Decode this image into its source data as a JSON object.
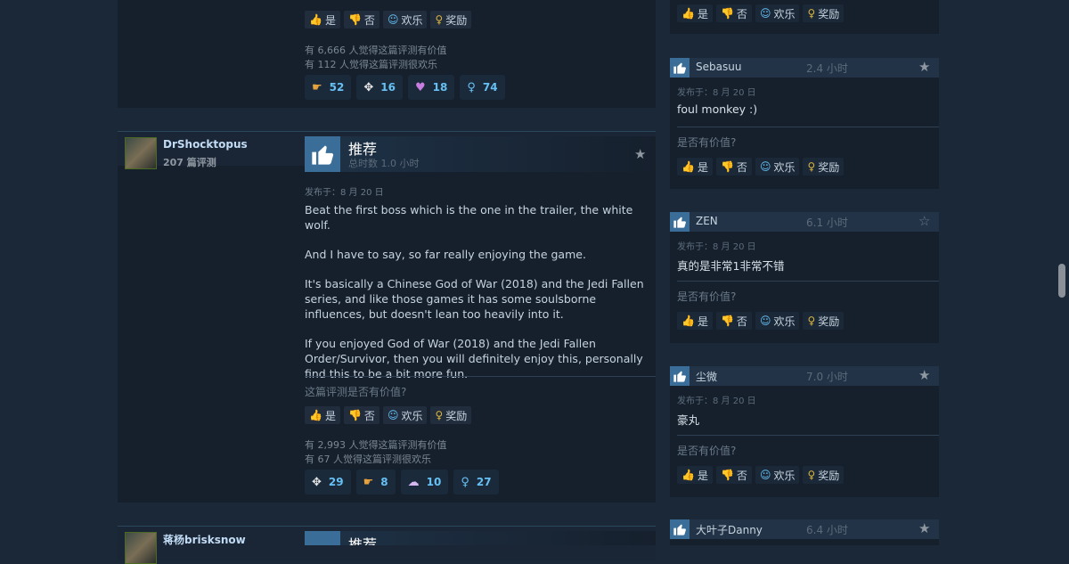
{
  "vote": {
    "yes": "是",
    "no": "否",
    "funny": "欢乐",
    "award": "奖励"
  },
  "review_top": {
    "helpful_count_text": "有 6,666 人觉得这篇评测有价值",
    "funny_count_text": "有 112 人觉得这篇评测很欢乐",
    "reactions": [
      {
        "icon": "hand-point-icon",
        "count": "52"
      },
      {
        "icon": "winged-icon",
        "count": "16"
      },
      {
        "icon": "heart-icon",
        "count": "18"
      },
      {
        "icon": "award-ribbon-icon",
        "count": "74"
      }
    ]
  },
  "review_main": {
    "author": "DrShocktopus",
    "review_count": "207 篇评测",
    "recommendation": "推荐",
    "hours": "总时数 1.0 小时",
    "posted": "发布于：8 月 20 日",
    "paragraphs": [
      "Beat the first boss which is the one in the trailer, the white wolf.",
      "And I have to say, so far really enjoying the game.",
      "It's basically a Chinese God of War (2018) and the Jedi Fallen series, and like those games it has some soulsborne influences, but doesn't lean too heavily into it.",
      "If you enjoyed God of War (2018) and the Jedi Fallen Order/Survivor, then you will definitely enjoy this, personally find this to be a bit more fun."
    ],
    "helpful_question": "这篇评测是否有价值?",
    "helpful_count_text": "有 2,993 人觉得这篇评测有价值",
    "funny_count_text": "有 67 人觉得这篇评测很欢乐",
    "reactions": [
      {
        "icon": "winged-icon",
        "count": "29"
      },
      {
        "icon": "hand-point-icon",
        "count": "8"
      },
      {
        "icon": "cloud-icon",
        "count": "10"
      },
      {
        "icon": "award-ribbon-icon",
        "count": "27"
      }
    ]
  },
  "review_bottom": {
    "author": "蒋杨brisksnow",
    "recommendation": "推荐"
  },
  "comments": [
    {
      "name": "Sebasuu",
      "hours": "2.4 小时",
      "posted": "发布于：8 月 20 日",
      "text": "foul monkey :)",
      "helpful_q": "是否有价值?"
    },
    {
      "name": "ZEN",
      "hours": "6.1 小时",
      "posted": "发布于：8 月 20 日",
      "text": "真的是非常1非常不错",
      "helpful_q": "是否有价值?"
    },
    {
      "name": "尘微",
      "hours": "7.0 小时",
      "posted": "发布于：8 月 20 日",
      "text": "豪丸",
      "helpful_q": "是否有价值?"
    },
    {
      "name": "大叶子Danny",
      "hours": "6.4 小时"
    }
  ],
  "colors": {
    "accent": "#66c0f4",
    "award": "#d8b33c",
    "background": "#1b2838"
  }
}
